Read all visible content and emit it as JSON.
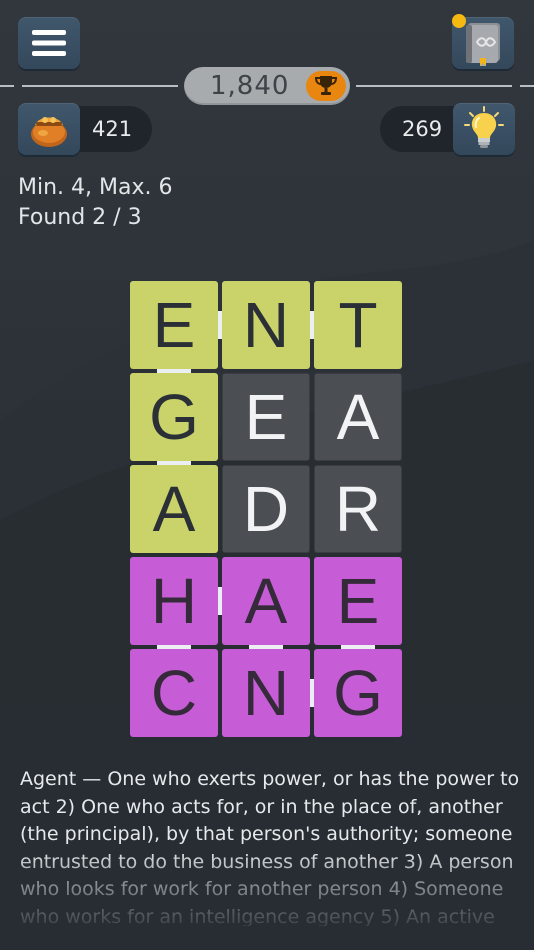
{
  "header": {
    "menu_icon": "hamburger-menu-icon",
    "book_icon": "infinity-book-icon",
    "has_notification": true
  },
  "score": {
    "value": "1,840",
    "icon": "trophy-icon"
  },
  "coins": {
    "value": "421",
    "icon": "coin-purse-icon"
  },
  "hints": {
    "value": "269",
    "icon": "lightbulb-icon"
  },
  "status": {
    "min_max": "Min. 4, Max. 6",
    "found": "Found 2 / 3"
  },
  "board": {
    "rows": 5,
    "cols": 3,
    "tiles": [
      [
        "E",
        "N",
        "T"
      ],
      [
        "G",
        "E",
        "A"
      ],
      [
        "A",
        "D",
        "R"
      ],
      [
        "H",
        "A",
        "E"
      ],
      [
        "C",
        "N",
        "G"
      ]
    ],
    "states": [
      [
        "yellow",
        "yellow",
        "yellow"
      ],
      [
        "yellow",
        "dark",
        "dark"
      ],
      [
        "yellow",
        "dark",
        "dark"
      ],
      [
        "purple",
        "purple",
        "purple"
      ],
      [
        "purple",
        "purple",
        "purple"
      ]
    ],
    "colors": {
      "yellow": "#c9d36a",
      "purple": "#c65dd6",
      "dark": "#4b4e52"
    }
  },
  "definition": {
    "text": "Agent — One who exerts power, or has the power to act 2) One who acts for, or in the place of, another (the principal), by that person's authority; someone entrusted to do the business of another 3) A person who looks for work for another person 4) Someone who works for an intelligence agency 5) An active"
  }
}
